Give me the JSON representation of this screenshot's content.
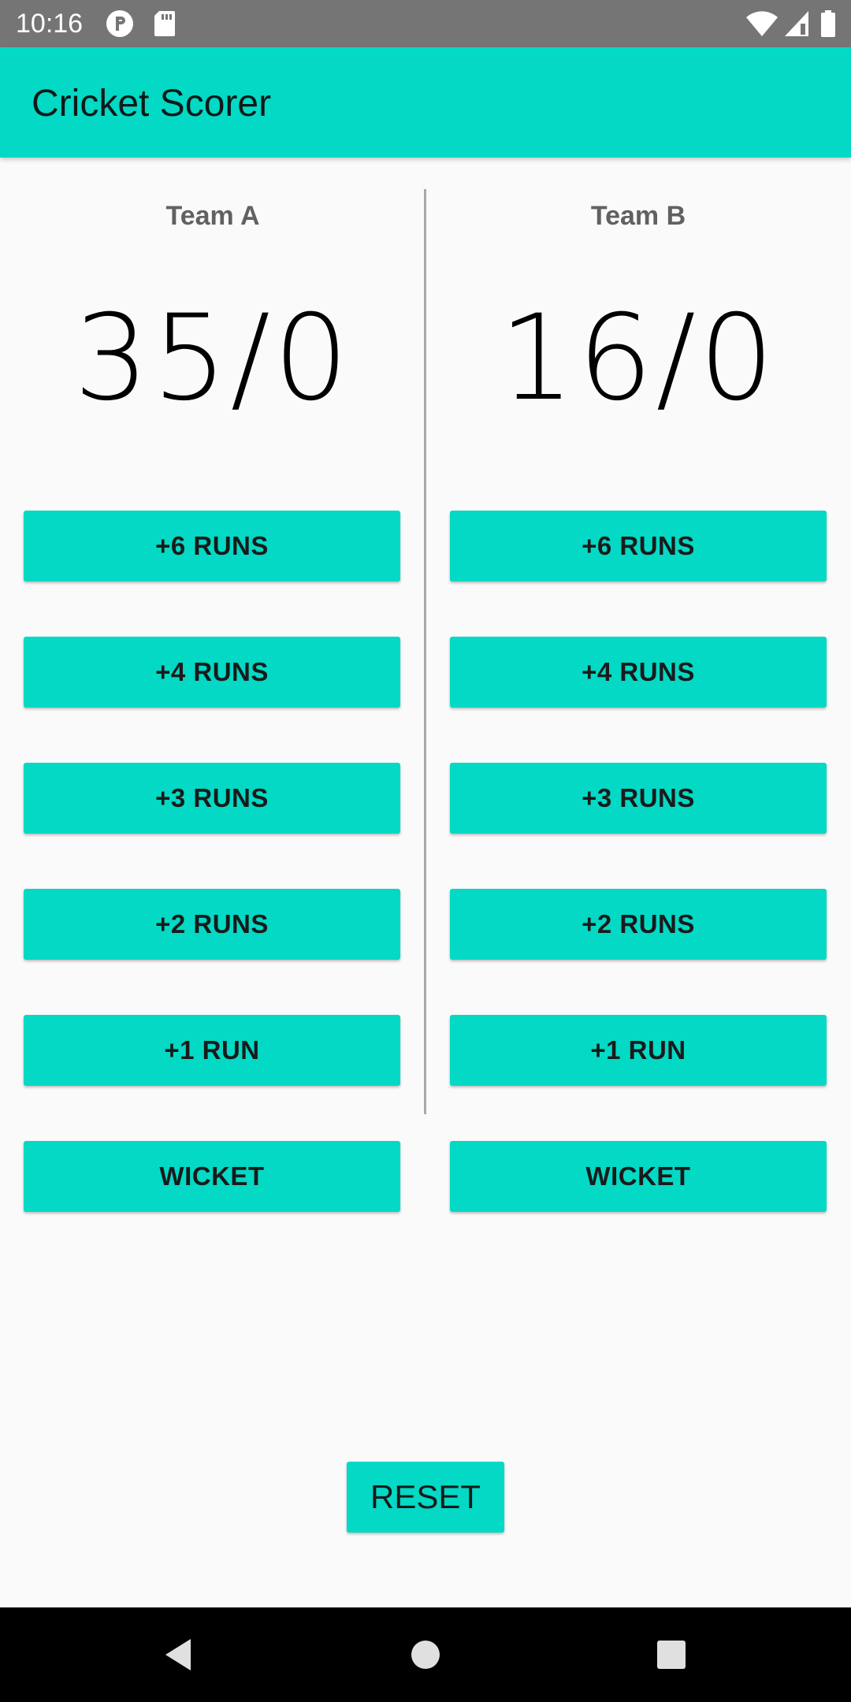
{
  "status_bar": {
    "time": "10:16",
    "icons": [
      "notification-p-icon",
      "sd-card-icon",
      "wifi-icon",
      "signal-icon",
      "battery-icon"
    ]
  },
  "app_bar": {
    "title": "Cricket Scorer"
  },
  "teams": [
    {
      "name": "Team A",
      "score": "35/0",
      "buttons": {
        "six": "+6 RUNS",
        "four": "+4 RUNS",
        "three": "+3 RUNS",
        "two": "+2 RUNS",
        "one": "+1 RUN",
        "wicket": "WICKET"
      }
    },
    {
      "name": "Team B",
      "score": "16/0",
      "buttons": {
        "six": "+6 RUNS",
        "four": "+4 RUNS",
        "three": "+3 RUNS",
        "two": "+2 RUNS",
        "one": "+1 RUN",
        "wicket": "WICKET"
      }
    }
  ],
  "reset_label": "RESET",
  "nav_bar": {
    "icons": [
      "back-icon",
      "home-icon",
      "recents-icon"
    ]
  },
  "colors": {
    "accent": "#03d9c5",
    "status_bar": "#757575",
    "background": "#fafafa",
    "nav_bar": "#000000"
  }
}
